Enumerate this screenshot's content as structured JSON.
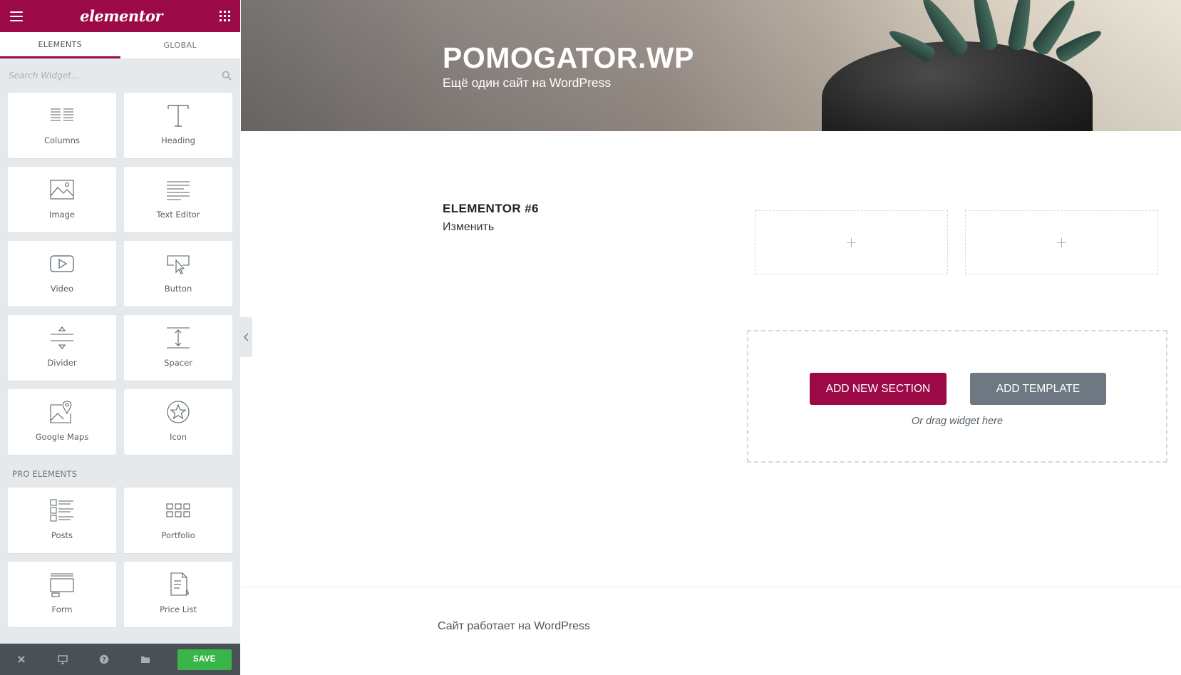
{
  "panel": {
    "logo": "elementor",
    "tabs": [
      {
        "label": "ELEMENTS",
        "active": true
      },
      {
        "label": "GLOBAL",
        "active": false
      }
    ],
    "search": {
      "placeholder": "Search Widget..."
    },
    "widgets": [
      {
        "label": "Columns",
        "icon": "columns-icon"
      },
      {
        "label": "Heading",
        "icon": "heading-icon"
      },
      {
        "label": "Image",
        "icon": "image-icon"
      },
      {
        "label": "Text Editor",
        "icon": "text-editor-icon"
      },
      {
        "label": "Video",
        "icon": "video-icon"
      },
      {
        "label": "Button",
        "icon": "button-icon"
      },
      {
        "label": "Divider",
        "icon": "divider-icon"
      },
      {
        "label": "Spacer",
        "icon": "spacer-icon"
      },
      {
        "label": "Google Maps",
        "icon": "google-maps-icon"
      },
      {
        "label": "Icon",
        "icon": "star-icon"
      }
    ],
    "pro_section_title": "PRO ELEMENTS",
    "pro_widgets": [
      {
        "label": "Posts",
        "icon": "posts-icon"
      },
      {
        "label": "Portfolio",
        "icon": "portfolio-icon"
      },
      {
        "label": "Form",
        "icon": "form-icon"
      },
      {
        "label": "Price List",
        "icon": "price-list-icon"
      }
    ],
    "footer": {
      "save_label": "SAVE",
      "icons": [
        "close-icon",
        "desktop-icon",
        "help-icon",
        "folder-icon"
      ]
    }
  },
  "site": {
    "title": "POMOGATOR.WP",
    "tagline": "Ещё один сайт на WordPress"
  },
  "post": {
    "title": "ELEMENTOR #6",
    "edit_link": "Изменить"
  },
  "columns": [
    {
      "placeholder": "+"
    },
    {
      "placeholder": "+"
    }
  ],
  "add_section": {
    "add_new_label": "ADD NEW SECTION",
    "add_template_label": "ADD TEMPLATE",
    "drag_hint": "Or drag widget here"
  },
  "footer": {
    "text": "Сайт работает на WordPress"
  },
  "colors": {
    "brand": "#9b0a46",
    "save": "#39b54a",
    "template_button": "#6d7882",
    "panel_bg": "#e6e9ec",
    "panel_footer": "#495157"
  }
}
